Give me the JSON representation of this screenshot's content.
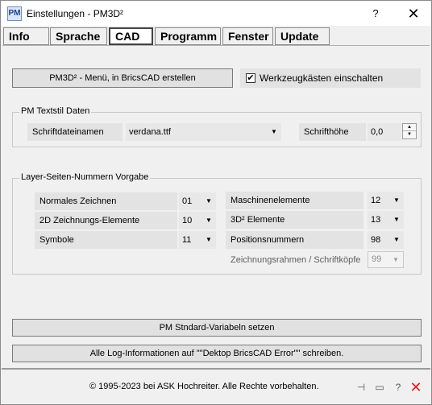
{
  "window": {
    "title": "Einstellungen - PM3D²",
    "icon_text": "PM",
    "help_glyph": "?",
    "close_glyph": "✕"
  },
  "tabs": [
    {
      "label": "Info"
    },
    {
      "label": "Sprache"
    },
    {
      "label": "CAD"
    },
    {
      "label": "Programm"
    },
    {
      "label": "Fenster"
    },
    {
      "label": "Update"
    }
  ],
  "cad": {
    "menu_button": "PM3D² - Menü, in BricsCAD erstellen",
    "toolbox_checkbox": {
      "label": "Werkzeugkästen einschalten",
      "checked": true,
      "mark": "✔"
    },
    "textstyle": {
      "group_title": "PM Textstil Daten",
      "font_label": "Schriftdateinamen",
      "font_value": "verdana.ttf",
      "height_label": "Schrifthöhe",
      "height_value": "0,0"
    },
    "layer": {
      "group_title": "Layer-Seiten-Nummern Vorgabe",
      "left": [
        {
          "label": "Normales Zeichnen",
          "value": "01"
        },
        {
          "label": "2D Zeichnungs-Elemente",
          "value": "10"
        },
        {
          "label": "Symbole",
          "value": "11"
        }
      ],
      "right": [
        {
          "label": "Maschinenelemente",
          "value": "12"
        },
        {
          "label": "3D² Elemente",
          "value": "13"
        },
        {
          "label": "Positionsnummern",
          "value": "98"
        },
        {
          "label": "Zeichnungsrahmen / Schriftköpfe",
          "value": "99",
          "disabled": true
        }
      ]
    },
    "reset_button": "PM Stndard-Variabeln setzen",
    "log_button": "Alle Log-Informationen auf \"\"Dektop BricsCAD Error\"\" schreiben."
  },
  "footer": {
    "copyright": "© 1995-2023 bei ASK Hochreiter. Alle Rechte vorbehalten.",
    "pin_glyph": "⊣",
    "minimize_glyph": "▭",
    "help_glyph": "?",
    "close_glyph": "✕",
    "close_color": "#e01b24"
  }
}
